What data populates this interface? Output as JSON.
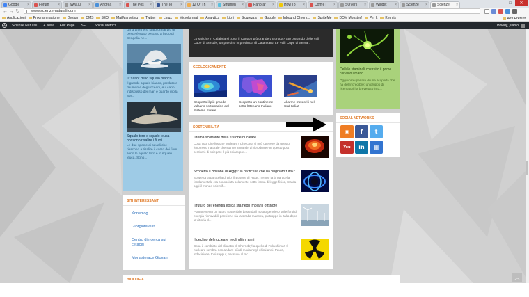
{
  "browser": {
    "tabs": [
      {
        "label": "Google",
        "color": "#4285f4",
        "active": false
      },
      {
        "label": "Forum",
        "color": "#d9534f",
        "active": false
      },
      {
        "label": "www.ju",
        "color": "#999999",
        "active": false
      },
      {
        "label": "Andrea",
        "color": "#4a90d9",
        "active": false
      },
      {
        "label": "The Pos",
        "color": "#d9534f",
        "active": false
      },
      {
        "label": "The To",
        "color": "#3b5998",
        "active": false
      },
      {
        "label": "12 Of Th",
        "color": "#f0ad4e",
        "active": false
      },
      {
        "label": "Strumen",
        "color": "#5bc0de",
        "active": false
      },
      {
        "label": "Panorar",
        "color": "#d9534f",
        "active": false
      },
      {
        "label": "How To",
        "color": "#f0c808",
        "active": false
      },
      {
        "label": "Com'è i",
        "color": "#d9534f",
        "active": false
      },
      {
        "label": "SOVers",
        "color": "#999999",
        "active": false
      },
      {
        "label": "Widget",
        "color": "#999999",
        "active": false
      },
      {
        "label": "Scienze",
        "color": "#999999",
        "active": false
      },
      {
        "label": "Scienze",
        "color": "#999999",
        "active": true
      }
    ],
    "address": "www.scienze-naturali.com",
    "bookmarks": [
      "Applicazioni",
      "Programmazione",
      "Design",
      "CMS",
      "SEO",
      "MailMarketing",
      "Twitter",
      "Linux",
      "Microformat",
      "Analytics",
      "Libri",
      "Sicurezza",
      "Google",
      "Inbound Chrom...",
      "SpriteMe",
      "DOM Monster!",
      "Pin It",
      "Kern.js"
    ],
    "bookmarks_right": "Altri Preferiti"
  },
  "adminbar": {
    "items": [
      "Scienze Naturali",
      "+ New",
      "Edit Page",
      "SEO",
      "Social Metrics"
    ],
    "howdy": "Howdy, juanio"
  },
  "left": {
    "intro_text": "Un granzo e lo stato ormai più di pesce è stato pescato a largo di Sengalia ne...",
    "article1_title": "Il \"salto\" dello squalo bianco",
    "article1_text": "Il grande squalo bianco, predatore dei mari e degli oceani, è il capo indiscusso dei mari e quanto molla ass...",
    "article2_title": "Squalo toro e squalo leuca possono risalire i fiumi",
    "article2_text": "Le due specie di squali che riescono a risalire il corso dei fiumi sono lo squalo toro e lo squalo leuca. Sono..."
  },
  "siti": {
    "header": "SITI INTERESSANTI",
    "links": [
      "Koneblog",
      "Giorgiotave.it",
      "Centro di ricerca sui cetacei",
      "Monasterace Giovani"
    ]
  },
  "topdark": {
    "text": "Lo sai che in Calabria si trova il Canyon più grande d'Europa? Sto parlando delle Valli Cupe di Sersale, un paesino in provincia di Catanzaro. Le Valli Cupe di Sersa..."
  },
  "geologicamente": {
    "header": "GEOLOGICAMENTE",
    "items": [
      {
        "caption": "Scoperto il più grande vulcano sottomarino del Sistema Solare"
      },
      {
        "caption": "Scoperto un continente sotto l'Oceano Indiano"
      },
      {
        "caption": "Allarme meteoriti nel Sud Italia!"
      }
    ]
  },
  "sostenibilita": {
    "header": "SOSTENIBILITÀ",
    "articles": [
      {
        "title": "Il tema scottante della fusione nucleare",
        "excerpt": "Cosa vuol dire fusione nucleare? Che cosa si può ottenere da questo fenomeno naturale che stanno tentando di riprodurre? In questo post cercherò di spiegare il più chiaro pos..."
      },
      {
        "title": "Scoperto il Bosone di Higgs: la particella che ha originato tutto?",
        "excerpt": "Scoperta la particella di Dio: il Bosone di Higgs. Tempo fa la particella fondamentale era conosciuta solamente sotto forma di legge fisica, ma da oggi il mondo scientifi..."
      },
      {
        "title": "Il futuro dell'energia eolica sta negli impianti offshore",
        "excerpt": "Puntare verso un futuro sostenibile basando il nostro pensiero sulle fonti di energia rinnovabili pensi che sia la strada maestra, purtroppo in Italia dopo la vittoria d..."
      },
      {
        "title": "Il declino del nucleare negli ultimi anni",
        "excerpt": "Cosa è cambiato dal disastro di Chernobyl a quello di Fukushima? Il nucleare sembra non andare più di moda negli ultimi anni. Paura, indecisione, toni seppur, nessuno al mo..."
      }
    ]
  },
  "biologia": {
    "header": "BIOLOGIA"
  },
  "right": {
    "title": "Cellule staminali costruito il primo cervello umano",
    "text": "Oggi vorrei parlare di una scoperta che ha dell'incredibile: un gruppo di ricercatori ha brevettato in L..."
  },
  "social": {
    "header": "SOCIAL NETWORKS",
    "icons": [
      {
        "name": "rss-icon",
        "glyph": "◉",
        "color": "#ef7d24"
      },
      {
        "name": "facebook-icon",
        "glyph": "f",
        "color": "#3b5998"
      },
      {
        "name": "twitter-icon",
        "glyph": "t",
        "color": "#55acee"
      },
      {
        "name": "youtube-icon",
        "glyph": "You",
        "color": "#c4302b"
      },
      {
        "name": "linkedin-icon",
        "glyph": "in",
        "color": "#0e76a8"
      },
      {
        "name": "delicious-icon",
        "glyph": "▦",
        "color": "#3274d0"
      }
    ]
  }
}
